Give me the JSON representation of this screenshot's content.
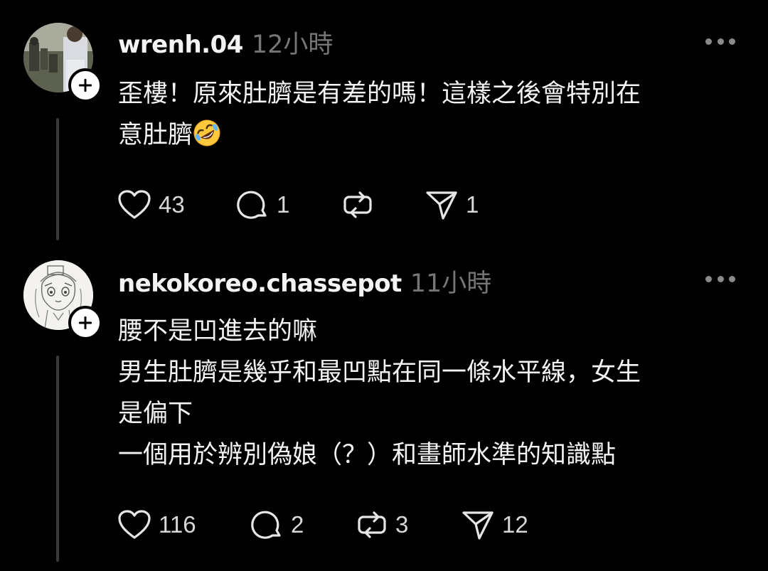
{
  "posts": [
    {
      "username": "wrenh.04",
      "timestamp": "12小時",
      "avatar_icon": "photo-avatar-icon",
      "lines": [
        "歪樓！原來肚臍是有差的嗎！這樣之後會特別在",
        "意肚臍"
      ],
      "emoji": "rolling-on-floor-laughing-emoji",
      "actions": {
        "likes": "43",
        "replies": "1",
        "reposts": "",
        "shares": "1"
      }
    },
    {
      "username": "nekokoreo.chassepot",
      "timestamp": "11小時",
      "avatar_icon": "sketch-avatar-icon",
      "lines": [
        "腰不是凹進去的嘛",
        "男生肚臍是幾乎和最凹點在同一條水平線，女生",
        "是偏下",
        "一個用於辨別偽娘（？）和畫師水準的知識點"
      ],
      "actions": {
        "likes": "116",
        "replies": "2",
        "reposts": "3",
        "shares": "12"
      }
    }
  ],
  "colors": {
    "background": "#000000",
    "text": "#f3f3f3",
    "muted": "#767676",
    "thread_line": "#3a3a3a"
  }
}
